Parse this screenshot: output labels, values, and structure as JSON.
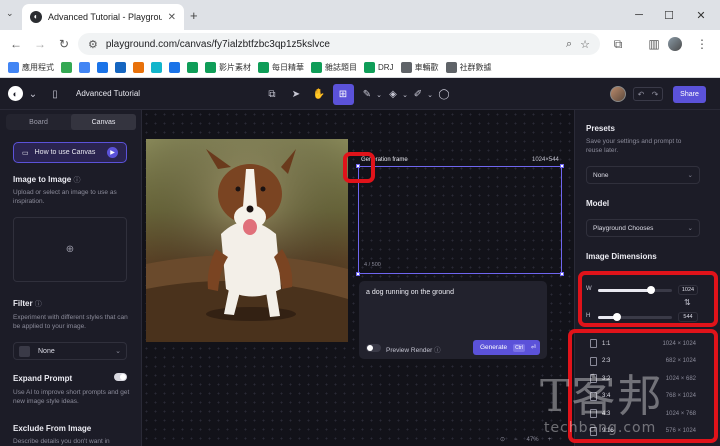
{
  "browser": {
    "tab_title": "Advanced Tutorial - Playgrou",
    "url": "playground.com/canvas/fy7ialzbtfzbc3qp1z5kslvce",
    "bookmarks": [
      {
        "label": "應用程式",
        "color": "#4285f4"
      },
      {
        "label": "",
        "color": "#34a853"
      },
      {
        "label": "",
        "color": "#4285f4"
      },
      {
        "label": "",
        "color": "#1a73e8"
      },
      {
        "label": "",
        "color": "#1565c0"
      },
      {
        "label": "",
        "color": "#e8710a"
      },
      {
        "label": "",
        "color": "#12b5cb"
      },
      {
        "label": "",
        "color": "#1a73e8"
      },
      {
        "label": "",
        "color": "#0f9d58"
      },
      {
        "label": "影片素材",
        "color": "#0f9d58"
      },
      {
        "label": "每日精華",
        "color": "#0f9d58"
      },
      {
        "label": "雜誌題目",
        "color": "#0f9d58"
      },
      {
        "label": "DRJ",
        "color": "#0f9d58"
      },
      {
        "label": "車輛歡",
        "color": "#5f6368"
      },
      {
        "label": "社群數據",
        "color": "#5f6368"
      }
    ]
  },
  "app": {
    "project_name": "Advanced Tutorial",
    "share_label": "Share",
    "left_panel": {
      "tabs": [
        "Board",
        "Canvas"
      ],
      "how_to_label": "How to use Canvas",
      "image_to_image": {
        "title": "Image to Image",
        "desc": "Upload or select an image to use as inspiration."
      },
      "filter": {
        "title": "Filter",
        "desc": "Experiment with different styles that can be applied to your image.",
        "value": "None"
      },
      "expand_prompt": {
        "title": "Expand Prompt",
        "desc": "Use AI to improve short prompts and get new image style ideas.",
        "enabled": true
      },
      "exclude": {
        "title": "Exclude From Image",
        "desc": "Describe details you don't want in"
      }
    },
    "canvas": {
      "frame_label": "Generation frame",
      "frame_size": "1024×544",
      "char_count": "4 / 500",
      "prompt": "a dog running on the ground",
      "preview_label": "Preview Render",
      "generate_label": "Generate",
      "generate_shortcut": "Ctrl",
      "zoom": "47%"
    },
    "right_panel": {
      "presets": {
        "title": "Presets",
        "desc": "Save your settings and prompt to reuse later.",
        "value": "None"
      },
      "model": {
        "title": "Model",
        "value": "Playground Chooses"
      },
      "image_dimensions": {
        "title": "Image Dimensions",
        "w_label": "W",
        "w_value": "1024",
        "h_label": "H",
        "h_value": "544",
        "w_level": 0.72,
        "h_level": 0.25,
        "ratios": [
          {
            "label": "1:1",
            "value": "1024 × 1024"
          },
          {
            "label": "2:3",
            "value": "682 × 1024"
          },
          {
            "label": "3:2",
            "value": "1024 × 682"
          },
          {
            "label": "3:4",
            "value": "768 × 1024"
          },
          {
            "label": "4:3",
            "value": "1024 × 768"
          },
          {
            "label": "9:16",
            "value": "576 × 1024"
          }
        ]
      }
    }
  },
  "watermark": {
    "big": "T客邦",
    "small": "techbang.com"
  }
}
